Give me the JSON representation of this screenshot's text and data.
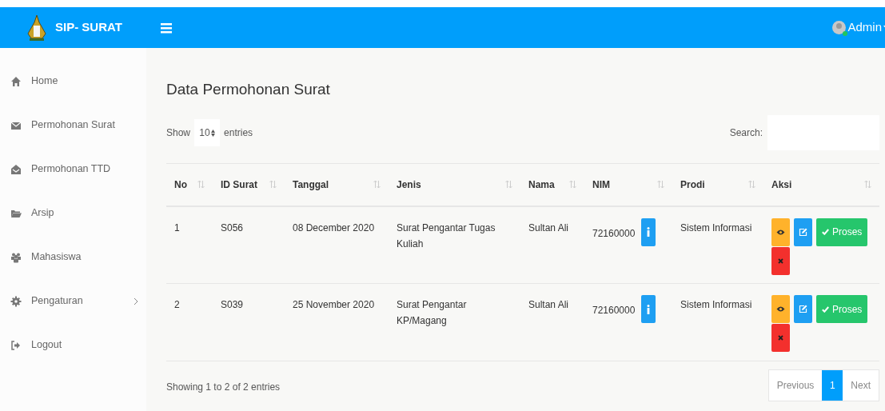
{
  "brand": {
    "title": "SIP- SURAT"
  },
  "user": {
    "name": "Admin",
    "online": true
  },
  "sidebar": {
    "items": [
      {
        "label": "Home",
        "has_submenu": false
      },
      {
        "label": "Permohonan Surat",
        "has_submenu": false
      },
      {
        "label": "Permohonan TTD",
        "has_submenu": false
      },
      {
        "label": "Arsip",
        "has_submenu": false
      },
      {
        "label": "Mahasiswa",
        "has_submenu": false
      },
      {
        "label": "Pengaturan",
        "has_submenu": true
      },
      {
        "label": "Logout",
        "has_submenu": false
      }
    ]
  },
  "page_title": "Data Permohonan Surat",
  "length_control": {
    "prefix": "Show",
    "value": "10",
    "suffix": "entries"
  },
  "search": {
    "label": "Search:"
  },
  "table": {
    "columns": [
      "No",
      "ID Surat",
      "Tanggal",
      "Jenis",
      "Nama",
      "NIM",
      "Prodi",
      "Aksi"
    ],
    "rows": [
      {
        "no": "1",
        "id": "S056",
        "tanggal": "08 December 2020",
        "jenis": "Surat Pengantar Tugas Kuliah",
        "nama": "Sultan Ali",
        "nim": "72160000",
        "prodi": "Sistem Informasi",
        "actions": [
          {
            "kind": "view"
          },
          {
            "kind": "edit"
          },
          {
            "kind": "process",
            "label": "Proses"
          },
          {
            "kind": "delete"
          }
        ]
      },
      {
        "no": "2",
        "id": "S039",
        "tanggal": "25 November 2020",
        "jenis": "Surat Pengantar KP/Magang",
        "nama": "Sultan Ali",
        "nim": "72160000",
        "prodi": "Sistem Informasi",
        "actions": [
          {
            "kind": "view"
          },
          {
            "kind": "edit"
          },
          {
            "kind": "process",
            "label": "Proses"
          },
          {
            "kind": "delete"
          }
        ]
      }
    ]
  },
  "info": "Showing 1 to 2 of 2 entries",
  "pagination": {
    "previous": "Previous",
    "next": "Next",
    "pages": [
      {
        "label": "1",
        "selected": true
      }
    ]
  }
}
